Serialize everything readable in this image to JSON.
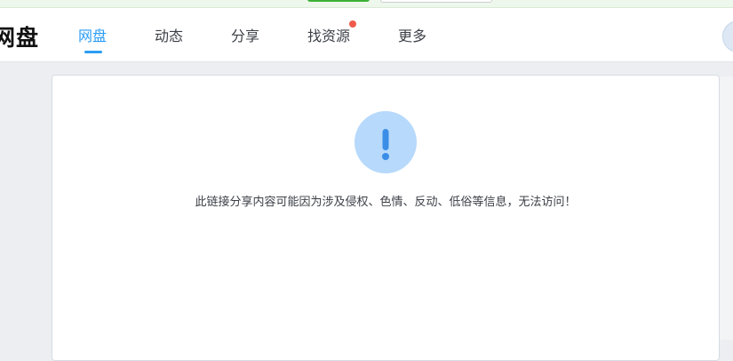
{
  "header": {
    "logo_text": "网盘",
    "nav": [
      {
        "label": "网盘",
        "active": true
      },
      {
        "label": "动态"
      },
      {
        "label": "分享"
      },
      {
        "label": "找资源",
        "badge": "red-dot"
      },
      {
        "label": "更多"
      }
    ]
  },
  "main": {
    "alert_icon": "exclamation-icon",
    "message": "此链接分享内容可能因为涉及侵权、色情、反动、低俗等信息，无法访问！"
  },
  "colors": {
    "accent": "#2a9df4",
    "alert_circle": "#b7d9fb",
    "badge": "#f05a4a",
    "top_button_green": "#3cb034"
  }
}
